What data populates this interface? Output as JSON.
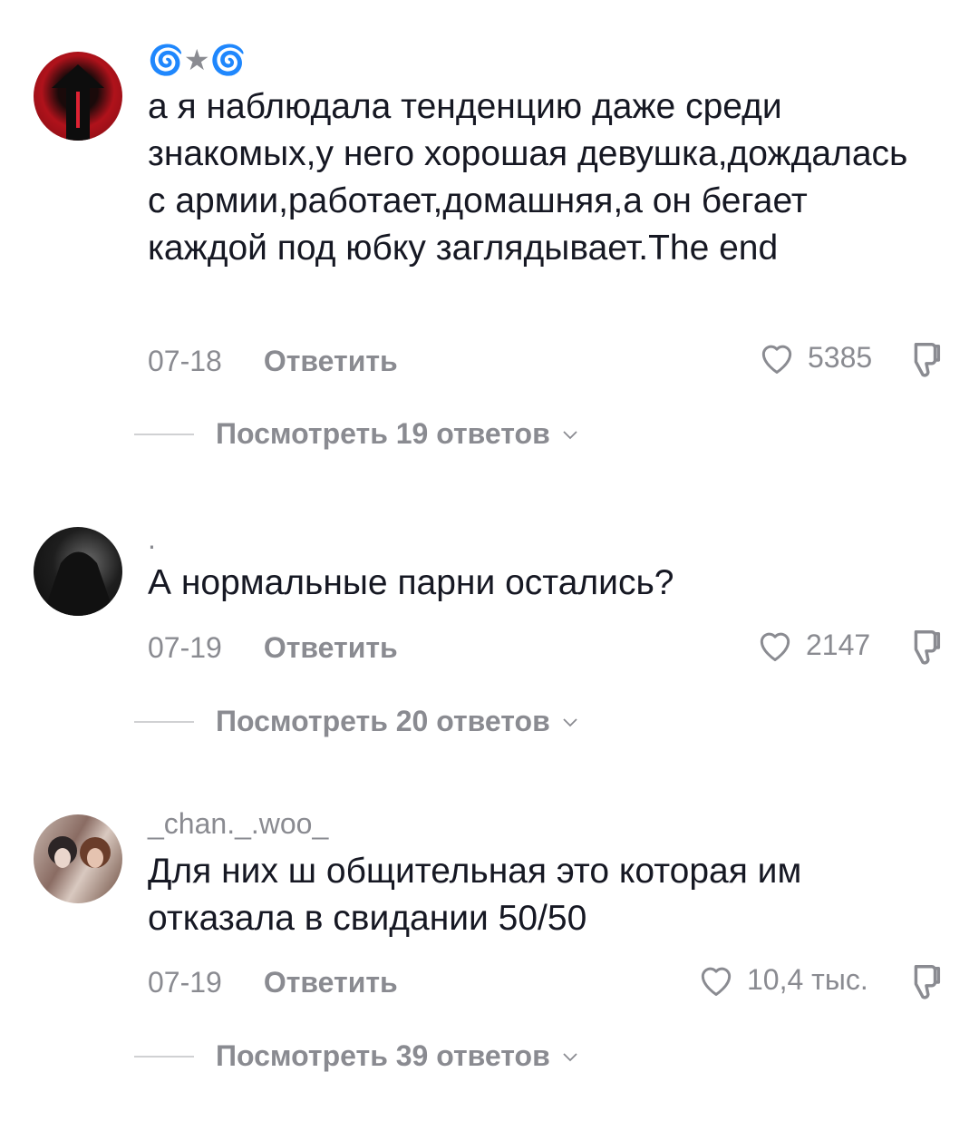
{
  "comments": [
    {
      "username": "🌀★🌀",
      "text": "а я наблюдала тенденцию даже среди знакомых,у него хорошая девушка,дождалась с армии,работает,домашняя,а он бегает каждой под юбку заглядывает.The end",
      "date": "07-18",
      "reply_label": "Ответить",
      "likes": "5385",
      "view_replies": "Посмотреть 19 ответов"
    },
    {
      "username": ".",
      "text": "А нормальные парни остались?",
      "date": "07-19",
      "reply_label": "Ответить",
      "likes": "2147",
      "view_replies": "Посмотреть 20 ответов"
    },
    {
      "username": "_chan._.woo_",
      "text": "Для них ш общительная это которая им отказала в свидании 50/50",
      "date": "07-19",
      "reply_label": "Ответить",
      "likes": "10,4 тыс.",
      "view_replies": "Посмотреть 39 ответов"
    }
  ],
  "icons": {
    "like": "heart-outline-icon",
    "dislike": "thumbs-down-outline-icon",
    "chevron": "chevron-down-icon"
  },
  "colors": {
    "text": "#161823",
    "secondary": "#8a8b91",
    "background": "#ffffff"
  }
}
